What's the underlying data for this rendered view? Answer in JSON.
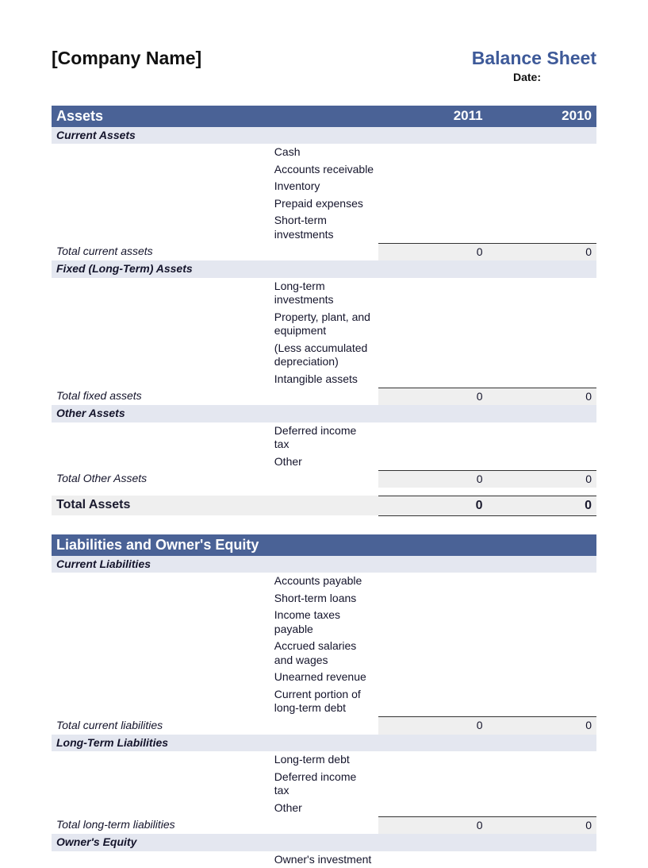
{
  "header": {
    "company": "[Company Name]",
    "title": "Balance Sheet",
    "date_label": "Date:"
  },
  "years": {
    "y1": "2011",
    "y2": "2010"
  },
  "assets": {
    "title": "Assets",
    "current": {
      "title": "Current Assets",
      "items": [
        "Cash",
        "Accounts receivable",
        "Inventory",
        "Prepaid expenses",
        "Short-term investments"
      ],
      "total_label": "Total current assets",
      "total_y1": "0",
      "total_y2": "0"
    },
    "fixed": {
      "title": "Fixed (Long-Term) Assets",
      "items": [
        "Long-term investments",
        "Property, plant, and equipment",
        "(Less accumulated depreciation)",
        "Intangible assets"
      ],
      "total_label": "Total fixed assets",
      "total_y1": "0",
      "total_y2": "0"
    },
    "other": {
      "title": "Other Assets",
      "items": [
        "Deferred income tax",
        "Other"
      ],
      "total_label": "Total Other Assets",
      "total_y1": "0",
      "total_y2": "0"
    },
    "grand_label": "Total Assets",
    "grand_y1": "0",
    "grand_y2": "0"
  },
  "liab": {
    "title": "Liabilities and Owner's Equity",
    "current": {
      "title": "Current Liabilities",
      "items": [
        "Accounts payable",
        "Short-term loans",
        "Income taxes payable",
        "Accrued salaries and wages",
        "Unearned revenue",
        "Current portion of long-term debt"
      ],
      "total_label": "Total current liabilities",
      "total_y1": "0",
      "total_y2": "0"
    },
    "longterm": {
      "title": "Long-Term Liabilities",
      "items": [
        "Long-term debt",
        "Deferred income tax",
        "Other"
      ],
      "total_label": "Total long-term liabilities",
      "total_y1": "0",
      "total_y2": "0"
    },
    "equity": {
      "title": "Owner's Equity",
      "items": [
        "Owner's investment"
      ]
    }
  }
}
